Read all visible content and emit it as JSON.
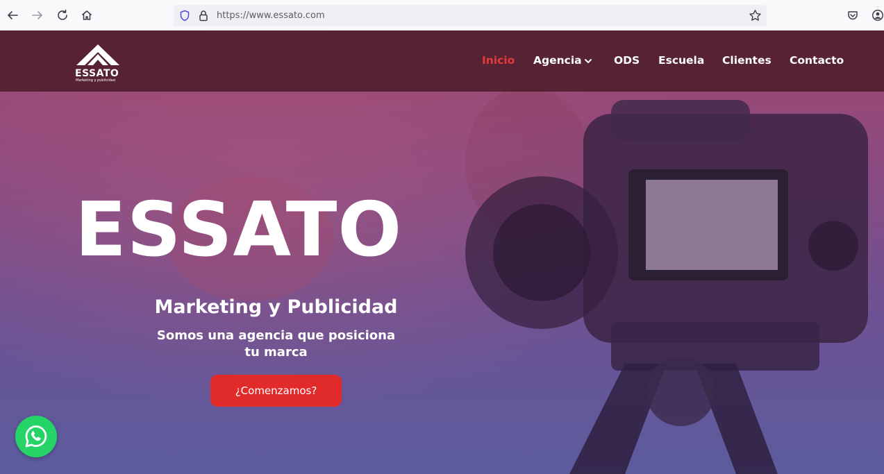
{
  "browser": {
    "url": "https://www.essato.com",
    "icons": [
      "back-icon",
      "forward-icon",
      "reload-icon",
      "home-icon",
      "shield-icon",
      "lock-icon",
      "bookmark-star-icon",
      "pocket-icon",
      "account-icon"
    ]
  },
  "site": {
    "logo": {
      "name": "ESSATO",
      "tagline": "Marketing y publicidad"
    },
    "nav": [
      {
        "label": "Inicio",
        "active": true
      },
      {
        "label": "Agencia",
        "has_dropdown": true
      },
      {
        "label": "ODS"
      },
      {
        "label": "Escuela"
      },
      {
        "label": "Clientes"
      },
      {
        "label": "Contacto"
      }
    ],
    "hero": {
      "title": "ESSATO",
      "subtitle": "Marketing y Publicidad",
      "description": "Somos una agencia que posiciona tu marca",
      "cta_label": "¿Comenzamos?"
    },
    "floating": {
      "icon": "whatsapp-icon"
    }
  },
  "colors": {
    "accent": "#e12a2a",
    "active_nav": "#e53a3a",
    "header_bg": "#4e1c2c",
    "whatsapp": "#25d366"
  }
}
